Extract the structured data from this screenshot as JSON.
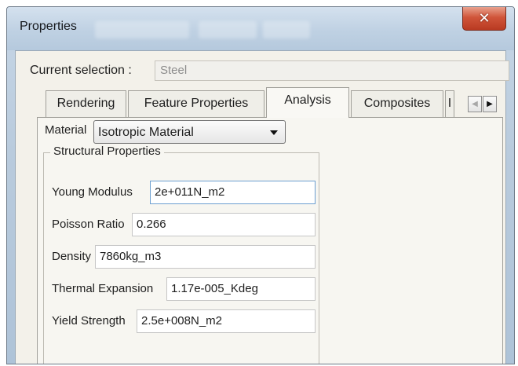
{
  "window": {
    "title": "Properties",
    "close_glyph": "✕"
  },
  "selection": {
    "label": "Current selection :",
    "value": "Steel"
  },
  "tabs": [
    {
      "label": "Rendering",
      "active": false
    },
    {
      "label": "Feature Properties",
      "active": false
    },
    {
      "label": "Analysis",
      "active": true
    },
    {
      "label": "Composites",
      "active": false
    },
    {
      "label": "I",
      "active": false
    }
  ],
  "tab_scroll": {
    "left": "◀",
    "right": "▶"
  },
  "material": {
    "label": "Material",
    "selected": "Isotropic Material"
  },
  "structural": {
    "title": "Structural Properties",
    "props": [
      {
        "label": "Young Modulus",
        "value": "2e+011N_m2"
      },
      {
        "label": "Poisson Ratio",
        "value": "0.266"
      },
      {
        "label": "Density",
        "value": "7860kg_m3"
      },
      {
        "label": "Thermal Expansion",
        "value": "1.17e-005_Kdeg"
      },
      {
        "label": "Yield Strength",
        "value": "2.5e+008N_m2"
      }
    ]
  },
  "colors": {
    "frame": "#b9cbdd",
    "close": "#c94a30",
    "panel": "#f3f1ea",
    "focus_border": "#6c9fd0"
  },
  "icons": {
    "close": "close-icon",
    "scroll_left": "chevron-left-icon",
    "scroll_right": "chevron-right-icon",
    "dropdown": "chevron-down-icon"
  }
}
